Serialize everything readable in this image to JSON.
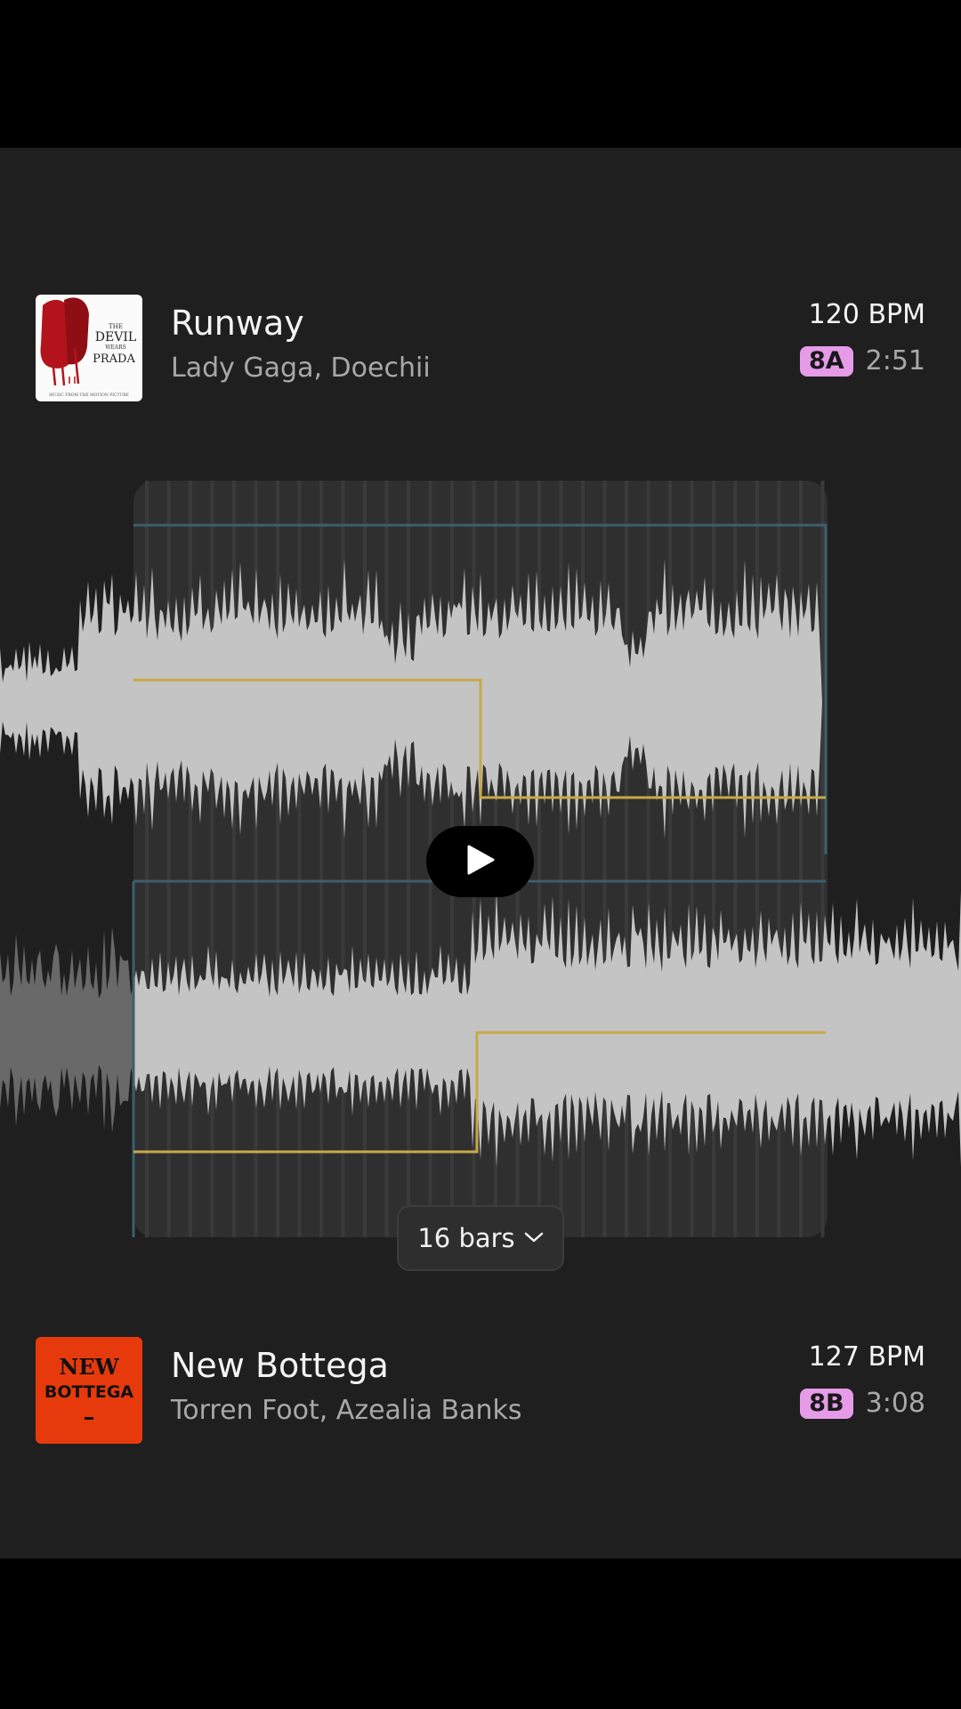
{
  "tracks": [
    {
      "title": "Runway",
      "artist": "Lady Gaga, Doechii",
      "bpm": "120 BPM",
      "key": "8A",
      "duration": "2:51",
      "cover": {
        "top_text": "THE",
        "main_text": "DEVIL",
        "sub_text": "WEARS",
        "brand": "PRADA",
        "footer": "MUSIC FROM THE MOTION PICTURE",
        "color": "#b3141b"
      }
    },
    {
      "title": "New Bottega",
      "artist": "Torren Foot, Azealia Banks",
      "bpm": "127 BPM",
      "key": "8B",
      "duration": "3:08",
      "cover": {
        "line1": "NEW",
        "line2": "BOTTEGA",
        "color": "#e63a0d"
      }
    }
  ],
  "transition": {
    "bars_label": "16 bars",
    "icons": {
      "play": "play-icon",
      "dropdown": "chevron-down-icon"
    },
    "colors": {
      "waveform": "#c4c4c4",
      "waveform_dim": "#6e6e6e",
      "volume_line": "#c7a94a",
      "region_line": "#3b5f6e",
      "key_badge": "#e59be7"
    }
  }
}
